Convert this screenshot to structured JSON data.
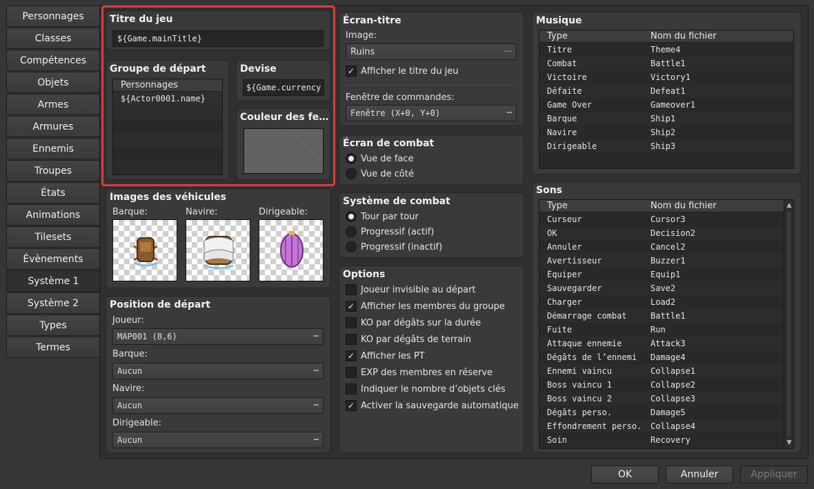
{
  "nav": [
    "Personnages",
    "Classes",
    "Compétences",
    "Objets",
    "Armes",
    "Armures",
    "Ennemis",
    "Troupes",
    "États",
    "Animations",
    "Tilesets",
    "Évènements",
    "Système 1",
    "Système 2",
    "Types",
    "Termes"
  ],
  "nav_active": "Système 1",
  "title_box": {
    "title": "Titre du jeu",
    "value": "${Game.mainTitle}"
  },
  "party_box": {
    "title": "Groupe de départ",
    "header": "Personnages",
    "rows": [
      "${Actor0001.name}"
    ]
  },
  "currency_box": {
    "title": "Devise",
    "value": "${Game.currency"
  },
  "window_color_box": {
    "title": "Couleur des fe…"
  },
  "vehicles_box": {
    "title": "Images des véhicules",
    "boat": "Barque:",
    "ship": "Navire:",
    "airship": "Dirigeable:"
  },
  "start_box": {
    "title": "Position de départ",
    "player_label": "Joueur:",
    "player_value": "MAP001 (8,6)",
    "boat_label": "Barque:",
    "boat_value": "Aucun",
    "ship_label": "Navire:",
    "ship_value": "Aucun",
    "airship_label": "Dirigeable:",
    "airship_value": "Aucun"
  },
  "title_screen_box": {
    "title": "Écran-titre",
    "image_label": "Image:",
    "image_value": "Ruins",
    "show_title_label": "Afficher le titre du jeu",
    "show_title_checked": true,
    "command_window_label": "Fenêtre de commandes:",
    "command_window_value": "Fenêtre (X+0, Y+0)"
  },
  "battle_screen_box": {
    "title": "Écran de combat",
    "options": [
      {
        "label": "Vue de face",
        "selected": true
      },
      {
        "label": "Vue de côté",
        "selected": false
      }
    ]
  },
  "battle_system_box": {
    "title": "Système de combat",
    "options": [
      {
        "label": "Tour par tour",
        "selected": true
      },
      {
        "label": "Progressif (actif)",
        "selected": false
      },
      {
        "label": "Progressif (inactif)",
        "selected": false
      }
    ]
  },
  "options_box": {
    "title": "Options",
    "items": [
      {
        "label": "Joueur invisible au départ",
        "checked": false
      },
      {
        "label": "Afficher les membres du groupe",
        "checked": true
      },
      {
        "label": "KO par dégâts sur la durée",
        "checked": false
      },
      {
        "label": "KO par dégâts de terrain",
        "checked": false
      },
      {
        "label": "Afficher les PT",
        "checked": true
      },
      {
        "label": "EXP des membres en réserve",
        "checked": false
      },
      {
        "label": "Indiquer le nombre d’objets clés",
        "checked": false
      },
      {
        "label": "Activer la sauvegarde automatique",
        "checked": true
      }
    ]
  },
  "music_box": {
    "title": "Musique",
    "col_type": "Type",
    "col_file": "Nom du fichier",
    "rows": [
      [
        "Titre",
        "Theme4"
      ],
      [
        "Combat",
        "Battle1"
      ],
      [
        "Victoire",
        "Victory1"
      ],
      [
        "Défaite",
        "Defeat1"
      ],
      [
        "Game Over",
        "Gameover1"
      ],
      [
        "Barque",
        "Ship1"
      ],
      [
        "Navire",
        "Ship2"
      ],
      [
        "Dirigeable",
        "Ship3"
      ]
    ]
  },
  "sounds_box": {
    "title": "Sons",
    "col_type": "Type",
    "col_file": "Nom du fichier",
    "rows": [
      [
        "Curseur",
        "Cursor3"
      ],
      [
        "OK",
        "Decision2"
      ],
      [
        "Annuler",
        "Cancel2"
      ],
      [
        "Avertisseur",
        "Buzzer1"
      ],
      [
        "Équiper",
        "Equip1"
      ],
      [
        "Sauvegarder",
        "Save2"
      ],
      [
        "Charger",
        "Load2"
      ],
      [
        "Démarrage combat",
        "Battle1"
      ],
      [
        "Fuite",
        "Run"
      ],
      [
        "Attaque ennemie",
        "Attack3"
      ],
      [
        "Dégâts de l’ennemi",
        "Damage4"
      ],
      [
        "Ennemi vaincu",
        "Collapse1"
      ],
      [
        "Boss vaincu 1",
        "Collapse2"
      ],
      [
        "Boss vaincu 2",
        "Collapse3"
      ],
      [
        "Dégâts perso.",
        "Damage5"
      ],
      [
        "Effondrement perso.",
        "Collapse4"
      ],
      [
        "Soin",
        "Recovery"
      ]
    ]
  },
  "buttons": {
    "ok": "OK",
    "cancel": "Annuler",
    "apply": "Appliquer"
  },
  "icons": {
    "dots": "⋯",
    "check": "✓",
    "scroll_up": "▲",
    "scroll_down": "▼"
  },
  "colors": {
    "highlight": "#e23b3b"
  }
}
